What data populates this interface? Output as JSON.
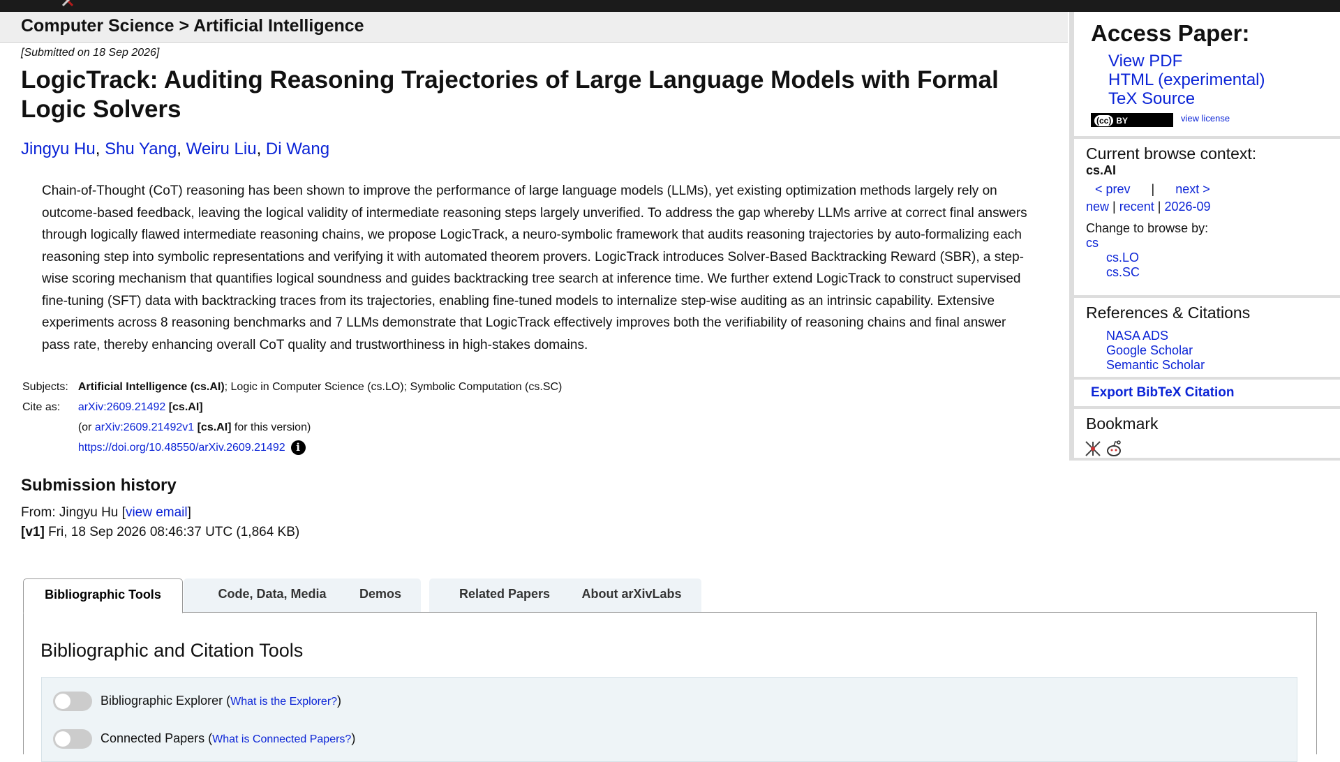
{
  "breadcrumb": {
    "text": "Computer Science > Artificial Intelligence"
  },
  "paper": {
    "submitted": "[Submitted on 18 Sep 2026]",
    "title": "LogicTrack: Auditing Reasoning Trajectories of Large Language Models with Formal Logic Solvers",
    "authors": [
      "Jingyu Hu",
      "Shu Yang",
      "Weiru Liu",
      "Di Wang"
    ],
    "abstract": "Chain-of-Thought (CoT) reasoning has been shown to improve the performance of large language models (LLMs), yet existing optimization methods largely rely on outcome-based feedback, leaving the logical validity of intermediate reasoning steps largely unverified. To address the gap whereby LLMs arrive at correct final answers through logically flawed intermediate reasoning chains, we propose LogicTrack, a neuro-symbolic framework that audits reasoning trajectories by auto-formalizing each reasoning step into symbolic representations and verifying it with automated theorem provers. LogicTrack introduces Solver-Based Backtracking Reward (SBR), a step-wise scoring mechanism that quantifies logical soundness and guides backtracking tree search at inference time. We further extend LogicTrack to construct supervised fine-tuning (SFT) data with backtracking traces from its trajectories, enabling fine-tuned models to internalize step-wise auditing as an intrinsic capability. Extensive experiments across 8 reasoning benchmarks and 7 LLMs demonstrate that LogicTrack effectively improves both the verifiability of reasoning chains and final answer pass rate, thereby enhancing overall CoT quality and trustworthiness in high-stakes domains."
  },
  "meta": {
    "subjects_label": "Subjects:",
    "subjects_primary": "Artificial Intelligence (cs.AI)",
    "subjects_rest": "; Logic in Computer Science (cs.LO); Symbolic Computation (cs.SC)",
    "cite_label": "Cite as:",
    "cite_id": "arXiv:2609.21492",
    "cite_cat": " [cs.AI]",
    "cite_ver_prefix": "(or ",
    "cite_ver_id": "arXiv:2609.21492v1",
    "cite_ver_cat": " [cs.AI]",
    "cite_ver_suffix": " for this version)",
    "doi": "https://doi.org/10.48550/arXiv.2609.21492",
    "info_glyph": "i"
  },
  "history": {
    "heading": "Submission history",
    "from_prefix": "From: Jingyu Hu [",
    "from_link": "view email",
    "from_suffix": "]",
    "version_tag": "[v1]",
    "version_text": " Fri, 18 Sep 2026 08:46:37 UTC (1,864 KB)"
  },
  "tabs": [
    "Bibliographic Tools",
    "Code, Data, Media",
    "Demos",
    "Related Papers",
    "About arXivLabs"
  ],
  "panel": {
    "heading": "Bibliographic and Citation Tools",
    "tools": [
      {
        "label": "Bibliographic Explorer (",
        "link": "What is the Explorer?",
        "suffix": ")"
      },
      {
        "label": "Connected Papers (",
        "link": "What is Connected Papers?",
        "suffix": ")"
      }
    ]
  },
  "sidebar": {
    "access": {
      "heading": "Access Paper:",
      "links": [
        "View PDF",
        "HTML (experimental)",
        "TeX Source"
      ],
      "license_badge_cc": "(cc)",
      "license_badge_by": "BY",
      "license_link": "view license"
    },
    "context": {
      "heading": "Current browse context:",
      "value": "cs.AI",
      "prev": "< prev",
      "sep": "|",
      "next": "next >",
      "new": "new",
      "recent": "recent",
      "month": "2026-09",
      "change_label": "Change to browse by:",
      "cats": [
        "cs",
        "cs.LO",
        "cs.SC"
      ]
    },
    "refs": {
      "heading": "References & Citations",
      "links": [
        "NASA ADS",
        "Google Scholar",
        "Semantic Scholar"
      ]
    },
    "bibtex": "Export BibTeX Citation",
    "bookmark": {
      "heading": "Bookmark"
    }
  }
}
